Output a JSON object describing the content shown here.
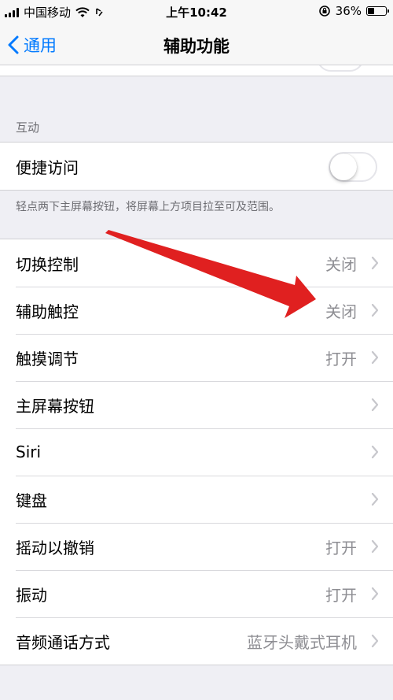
{
  "status_bar": {
    "carrier": "中国移动",
    "time": "上午10:42",
    "battery_percent": "36%",
    "battery_level": 0.36,
    "icons": [
      "signal-icon",
      "wifi-icon",
      "location-icon",
      "orientation-lock-icon",
      "battery-icon"
    ]
  },
  "nav": {
    "back_label": "通用",
    "title": "辅助功能"
  },
  "interaction_section": {
    "header": "互动",
    "reachability": {
      "label": "便捷访问",
      "toggle_on": false
    },
    "footer": "轻点两下主屏幕按钮，将屏幕上方项目拉至可及范围。"
  },
  "settings": [
    {
      "label": "切换控制",
      "value": "关闭"
    },
    {
      "label": "辅助触控",
      "value": "关闭"
    },
    {
      "label": "触摸调节",
      "value": "打开"
    },
    {
      "label": "主屏幕按钮",
      "value": ""
    },
    {
      "label": "Siri",
      "value": ""
    },
    {
      "label": "键盘",
      "value": ""
    },
    {
      "label": "摇动以撤销",
      "value": "打开"
    },
    {
      "label": "振动",
      "value": "打开"
    },
    {
      "label": "音频通话方式",
      "value": "蓝牙头戴式耳机"
    }
  ],
  "colors": {
    "accent": "#007aff",
    "annotation_arrow": "#e02020",
    "background": "#efeff4",
    "secondary_text": "#8e8e93"
  }
}
